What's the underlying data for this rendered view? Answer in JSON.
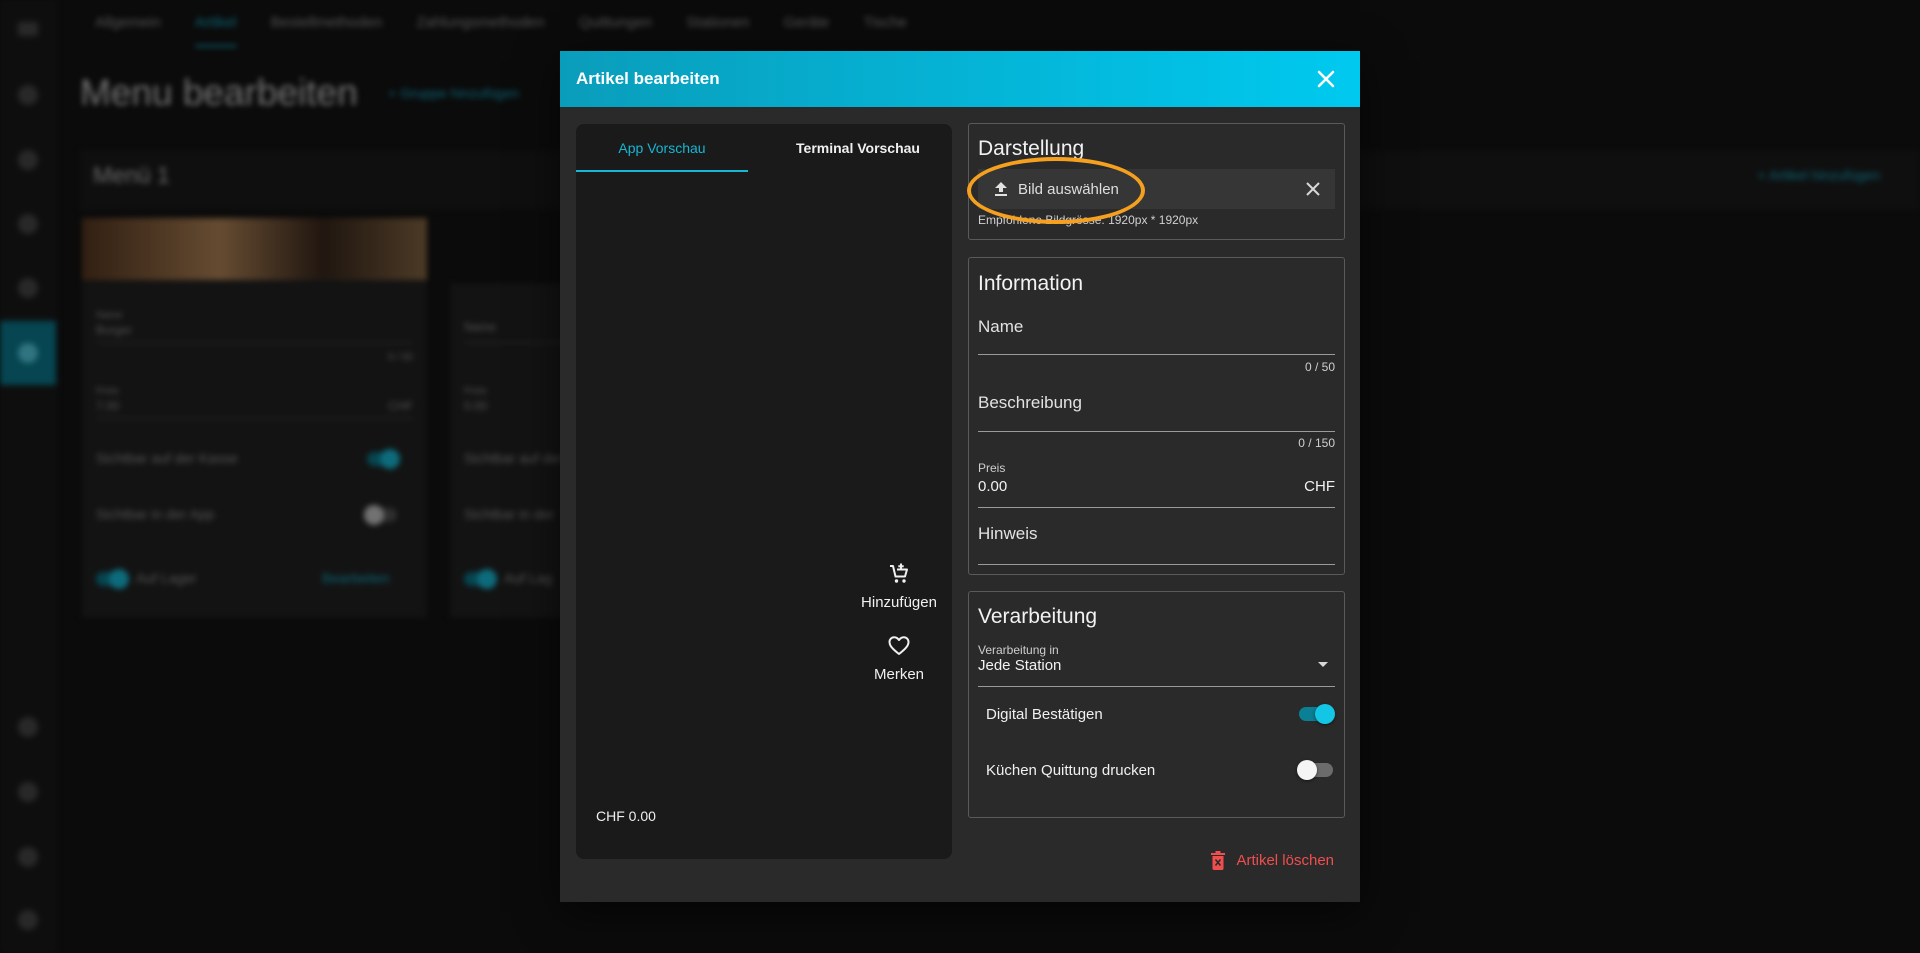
{
  "background": {
    "tabs": [
      "Allgemein",
      "Artikel",
      "Bestellmethoden",
      "Zahlungsmethoden",
      "Quittungen",
      "Stationen",
      "Geräte",
      "Tische"
    ],
    "active_tab": "Artikel",
    "page_title": "Menu bearbeiten",
    "add_group_label": "+ Gruppe hinzufügen",
    "add_article_label": "+ Artikel hinzufügen",
    "menu_name": "Menü 1",
    "card1": {
      "name_label": "Name",
      "name_value": "Burger",
      "counter": "6 / 50",
      "price_label": "Preis",
      "price_value": "7.00",
      "currency": "CHF",
      "toggle_kasse": "Sichtbar auf der Kasse",
      "toggle_app": "Sichtbar in der App",
      "stock_label": "Auf Lager",
      "edit_label": "Bearbeiten"
    },
    "card2": {
      "name_label": "Name",
      "price_label": "Preis",
      "price_value": "0.00",
      "toggle_kasse": "Sichtbar auf der K",
      "toggle_app": "Sichtbar in der",
      "stock_label": "Auf Lag"
    }
  },
  "modal": {
    "title": "Artikel bearbeiten",
    "close_icon": "close-icon",
    "preview": {
      "tabs": [
        {
          "label": "App Vorschau",
          "active": true
        },
        {
          "label": "Terminal Vorschau",
          "active": false
        }
      ],
      "add_label": "Hinzufügen",
      "save_label": "Merken",
      "price": "CHF 0.00"
    },
    "darstellung": {
      "title": "Darstellung",
      "upload_label": "Bild auswählen",
      "hint": "Empfohlene Bildgrösse: 1920px * 1920px"
    },
    "information": {
      "title": "Information",
      "name_label": "Name",
      "name_counter": "0 / 50",
      "description_label": "Beschreibung",
      "description_counter": "0 / 150",
      "price_label": "Preis",
      "price_value": "0.00",
      "price_suffix": "CHF",
      "note_label": "Hinweis"
    },
    "verarbeitung": {
      "title": "Verarbeitung",
      "select_label": "Verarbeitung in",
      "select_value": "Jede Station",
      "toggle_digital": {
        "label": "Digital Bestätigen",
        "on": true
      },
      "toggle_kitchen": {
        "label": "Küchen Quittung drucken",
        "on": false
      }
    },
    "delete_label": "Artikel löschen"
  },
  "colors": {
    "accent": "#16b6d4",
    "header_gradient_start": "#0a9dbb",
    "header_gradient_end": "#00c9ef",
    "danger": "#f04e4e",
    "highlight": "#f5a01f"
  }
}
